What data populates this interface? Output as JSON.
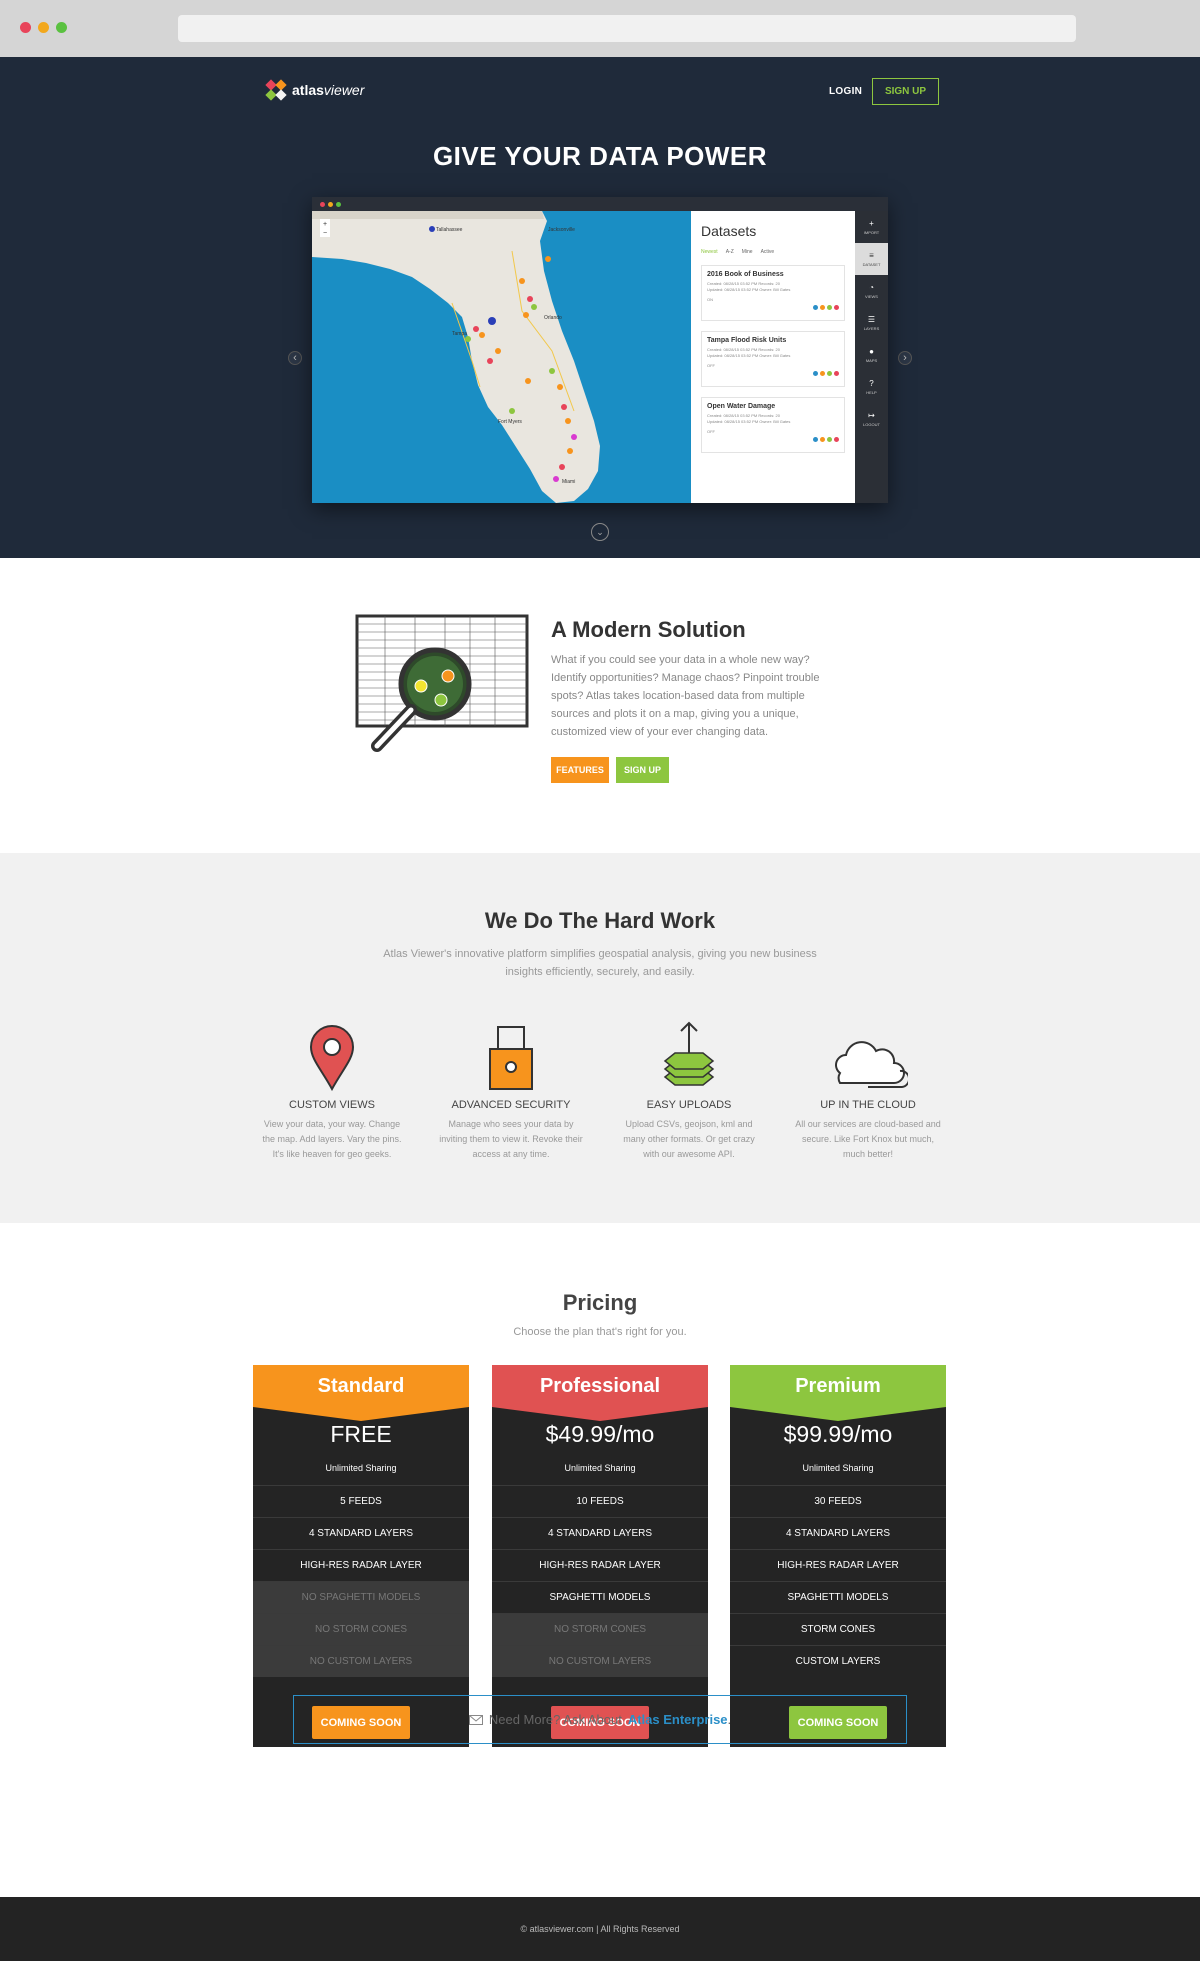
{
  "nav": {
    "brand_bold": "atlas",
    "brand_italic": "viewer",
    "login": "LOGIN",
    "signup": "SIGN UP"
  },
  "hero": {
    "title_light": "GIVE YOUR DATA",
    "title_bold": "POWER"
  },
  "mock_app": {
    "panel_title": "Datasets",
    "filters": [
      "Newest",
      "A-Z",
      "Mine",
      "Active"
    ],
    "datasets": [
      {
        "name": "2016 Book of Business",
        "created": "Created: 08/28/15 03:52 PM",
        "updated": "Updated: 08/28/15 03:52 PM",
        "records": "Records: 20",
        "owner": "Owner: Bill Gates",
        "status": "ON"
      },
      {
        "name": "Tampa Flood Risk Units",
        "created": "Created: 08/28/15 03:52 PM",
        "updated": "Updated: 08/28/15 03:52 PM",
        "records": "Records: 20",
        "owner": "Owner: Bill Gates",
        "status": "OFF"
      },
      {
        "name": "Open Water Damage",
        "created": "Created: 08/28/15 03:52 PM",
        "updated": "Updated: 08/28/15 03:52 PM",
        "records": "Records: 20",
        "owner": "Owner: Bill Gates",
        "status": "OFF"
      }
    ],
    "rail": [
      "IMPORT",
      "DATASET",
      "VIEWS",
      "LAYERS",
      "MAPS",
      "HELP",
      "LOGOUT"
    ],
    "map_labels": {
      "tallahassee": "Tallahassee",
      "jacksonville": "Jacksonville",
      "tampa": "Tampa",
      "orlando": "Orlando",
      "fort_myers": "Fort Myers",
      "miami": "Miami"
    }
  },
  "solution": {
    "title": "A Modern Solution",
    "text": "What if you could see your data in a whole new way? Identify opportunities? Manage chaos? Pinpoint trouble spots? Atlas takes location-based data from multiple sources and plots it on a map, giving you a unique, customized view of your ever changing data.",
    "features_btn": "FEATURES",
    "signup_btn": "SIGN UP"
  },
  "hard_work": {
    "title_light": "We Do The",
    "title_bold": "Hard Work",
    "subtitle": "Atlas Viewer's innovative platform simplifies geospatial analysis, giving you new business insights efficiently, securely, and easily.",
    "features": [
      {
        "icon": "map-pin-icon",
        "name": "CUSTOM VIEWS",
        "desc": "View your data, your way. Change the map. Add layers. Vary the pins. It's like heaven for geo geeks."
      },
      {
        "icon": "padlock-icon",
        "name": "ADVANCED SECURITY",
        "desc": "Manage who sees your data by inviting them to view it. Revoke their access at any time."
      },
      {
        "icon": "upload-stack-icon",
        "name": "EASY UPLOADS",
        "desc": "Upload CSVs, geojson, kml and many other formats. Or get crazy with our awesome API."
      },
      {
        "icon": "cloud-icon",
        "name": "UP IN THE CLOUD",
        "desc": "All our services are cloud-based and secure. Like Fort Knox but much, much better!"
      }
    ]
  },
  "pricing": {
    "title": "Pricing",
    "subtitle": "Choose the plan that's right for you.",
    "plans": [
      {
        "name": "Standard",
        "price": "FREE",
        "sharing": "Unlimited Sharing",
        "color": "#f7941d",
        "rows": [
          {
            "t": "5 FEEDS",
            "on": true
          },
          {
            "t": "4 STANDARD LAYERS",
            "on": true
          },
          {
            "t": "HIGH-RES RADAR LAYER",
            "on": true
          },
          {
            "t": "NO SPAGHETTI MODELS",
            "on": false
          },
          {
            "t": "NO STORM CONES",
            "on": false
          },
          {
            "t": "NO CUSTOM LAYERS",
            "on": false
          }
        ],
        "button": "COMING SOON"
      },
      {
        "name": "Professional",
        "price": "$49.99/mo",
        "sharing": "Unlimited Sharing",
        "color": "#e05252",
        "rows": [
          {
            "t": "10 FEEDS",
            "on": true
          },
          {
            "t": "4 STANDARD LAYERS",
            "on": true
          },
          {
            "t": "HIGH-RES RADAR LAYER",
            "on": true
          },
          {
            "t": "SPAGHETTI MODELS",
            "on": true
          },
          {
            "t": "NO STORM CONES",
            "on": false
          },
          {
            "t": "NO CUSTOM LAYERS",
            "on": false
          }
        ],
        "button": "COMING SOON"
      },
      {
        "name": "Premium",
        "price": "$99.99/mo",
        "sharing": "Unlimited Sharing",
        "color": "#8dc63f",
        "rows": [
          {
            "t": "30 FEEDS",
            "on": true
          },
          {
            "t": "4 STANDARD LAYERS",
            "on": true
          },
          {
            "t": "HIGH-RES RADAR LAYER",
            "on": true
          },
          {
            "t": "SPAGHETTI MODELS",
            "on": true
          },
          {
            "t": "STORM CONES",
            "on": true
          },
          {
            "t": "CUSTOM LAYERS",
            "on": true
          }
        ],
        "button": "COMING SOON"
      }
    ],
    "enterprise_text": "Need More? Ask About",
    "enterprise_link": "Atlas Enterprise",
    "enterprise_period": "."
  },
  "footer": {
    "text": "© atlasviewer.com | All Rights Reserved"
  }
}
